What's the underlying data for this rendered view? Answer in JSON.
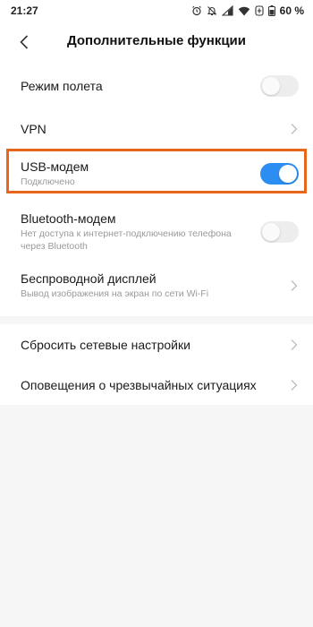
{
  "status": {
    "time": "21:27",
    "battery": "60 %"
  },
  "header": {
    "title": "Дополнительные функции"
  },
  "items": {
    "airplane": {
      "title": "Режим полета",
      "toggle": "off"
    },
    "vpn": {
      "title": "VPN"
    },
    "usb": {
      "title": "USB-модем",
      "subtitle": "Подключено",
      "toggle": "on"
    },
    "bluetooth": {
      "title": "Bluetooth-модем",
      "subtitle": "Нет доступа к интернет-подключению телефона через Bluetooth",
      "toggle": "off"
    },
    "wireless_display": {
      "title": "Беспроводной дисплей",
      "subtitle": "Вывод изображения на экран по сети Wi-Fi"
    },
    "reset_network": {
      "title": "Сбросить сетевые настройки"
    },
    "emergency_alerts": {
      "title": "Оповещения о чрезвычайных ситуациях"
    }
  },
  "colors": {
    "accent": "#2c8ef3",
    "highlight": "#e8661a",
    "background": "#f6f6f6"
  }
}
